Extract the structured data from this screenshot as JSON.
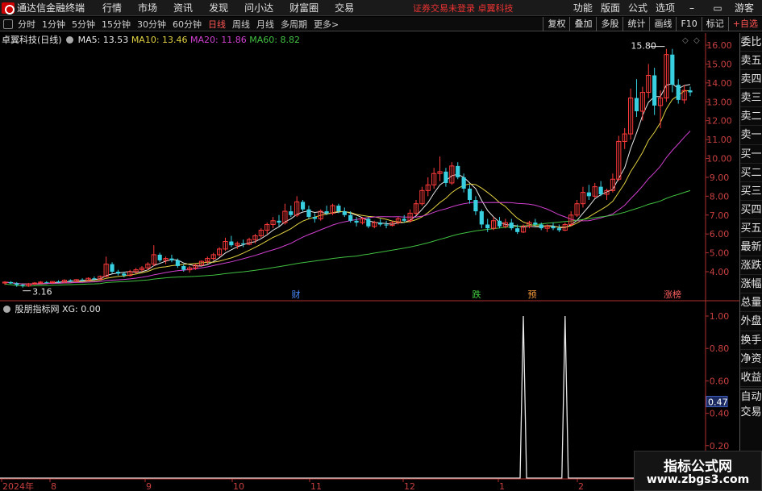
{
  "menubar": {
    "app_title": "通达信金融终端",
    "items": [
      "行情",
      "市场",
      "资讯",
      "发现",
      "问小达",
      "财富圈",
      "交易"
    ],
    "notice": "证券交易未登录  卓翼科技",
    "right_items": [
      "功能",
      "版面",
      "公式",
      "选项"
    ],
    "guest": "游客"
  },
  "periodbar": {
    "periods": [
      "分时",
      "1分钟",
      "5分钟",
      "15分钟",
      "30分钟",
      "60分钟",
      "日线",
      "周线",
      "月线",
      "多周期",
      "更多>"
    ],
    "active": "日线",
    "tools": [
      "复权",
      "叠加",
      "多股",
      "统计",
      "画线",
      "F10",
      "标记",
      "+自选"
    ]
  },
  "stock": {
    "name": "卓翼科技(日线)",
    "ma5": "MA5: 13.53",
    "ma10": "MA10: 13.46",
    "ma20": "MA20: 11.86",
    "ma60": "MA60: 8.82"
  },
  "indicator": {
    "name": "股朋指标网",
    "value": "XG: 0.00",
    "current_label": "0.47"
  },
  "sidebar": {
    "items": [
      "委比",
      "卖五",
      "卖四",
      "卖三",
      "卖二",
      "卖一",
      "买一",
      "买二",
      "买三",
      "买四",
      "买五",
      "最新",
      "涨跌",
      "涨幅",
      "总量",
      "外盘",
      "换手",
      "净资",
      "收益"
    ],
    "bottom": [
      "自动",
      "交易"
    ]
  },
  "chart_data": [
    {
      "type": "candlestick",
      "title": "卓翼科技(日线)",
      "ylim": [
        3.0,
        16.5
      ],
      "y_ticks": [
        "16.00",
        "15.00",
        "14.00",
        "13.00",
        "12.00",
        "11.00",
        "10.00",
        "9.00",
        "8.00",
        "7.00",
        "6.00",
        "5.00",
        "4.00"
      ],
      "annotations": [
        {
          "text": "15.80",
          "kind": "high"
        },
        {
          "text": "3.16",
          "kind": "low"
        }
      ],
      "event_markers": [
        {
          "text": "财",
          "color": "#4a8cff"
        },
        {
          "text": "跌",
          "color": "#40d040"
        },
        {
          "text": "预",
          "color": "#ffa040"
        },
        {
          "text": "涨榜",
          "color": "#ff6060"
        }
      ],
      "series": [
        {
          "name": "MA5",
          "color": "#e8e8e8"
        },
        {
          "name": "MA10",
          "color": "#e0d040"
        },
        {
          "name": "MA20",
          "color": "#d040d0"
        },
        {
          "name": "MA60",
          "color": "#40c040"
        }
      ],
      "ohlc_approx": [
        [
          3.4,
          3.5,
          3.3,
          3.45
        ],
        [
          3.45,
          3.5,
          3.35,
          3.38
        ],
        [
          3.38,
          3.45,
          3.2,
          3.3
        ],
        [
          3.3,
          3.36,
          3.16,
          3.25
        ],
        [
          3.25,
          3.4,
          3.2,
          3.35
        ],
        [
          3.35,
          3.45,
          3.3,
          3.4
        ],
        [
          3.4,
          3.5,
          3.35,
          3.45
        ],
        [
          3.45,
          3.5,
          3.38,
          3.42
        ],
        [
          3.42,
          3.5,
          3.35,
          3.48
        ],
        [
          3.48,
          3.55,
          3.4,
          3.45
        ],
        [
          3.45,
          3.6,
          3.4,
          3.55
        ],
        [
          3.55,
          3.6,
          3.45,
          3.5
        ],
        [
          3.5,
          3.6,
          3.45,
          3.58
        ],
        [
          3.58,
          3.65,
          3.5,
          3.55
        ],
        [
          3.55,
          3.7,
          3.5,
          3.65
        ],
        [
          3.65,
          3.75,
          3.55,
          3.6
        ],
        [
          3.6,
          3.8,
          3.55,
          3.75
        ],
        [
          3.75,
          4.8,
          3.7,
          4.4
        ],
        [
          4.4,
          4.5,
          3.9,
          4.0
        ],
        [
          4.0,
          4.1,
          3.8,
          3.9
        ],
        [
          3.9,
          4.0,
          3.7,
          3.8
        ],
        [
          3.8,
          4.1,
          3.75,
          4.0
        ],
        [
          4.0,
          4.2,
          3.9,
          4.1
        ],
        [
          4.1,
          4.3,
          4.0,
          4.2
        ],
        [
          4.2,
          4.5,
          4.1,
          4.4
        ],
        [
          4.4,
          5.4,
          4.3,
          4.9
        ],
        [
          4.9,
          5.0,
          4.5,
          4.6
        ],
        [
          4.6,
          4.8,
          4.4,
          4.7
        ],
        [
          4.7,
          4.9,
          4.5,
          4.6
        ],
        [
          4.6,
          4.7,
          4.2,
          4.3
        ],
        [
          4.3,
          4.4,
          4.0,
          4.1
        ],
        [
          4.1,
          4.3,
          3.95,
          4.2
        ],
        [
          4.2,
          4.4,
          4.1,
          4.35
        ],
        [
          4.35,
          4.6,
          4.3,
          4.55
        ],
        [
          4.55,
          4.8,
          4.4,
          4.7
        ],
        [
          4.7,
          5.0,
          4.6,
          4.9
        ],
        [
          4.9,
          5.3,
          4.8,
          5.2
        ],
        [
          5.2,
          5.8,
          5.1,
          5.6
        ],
        [
          5.6,
          5.9,
          5.3,
          5.4
        ],
        [
          5.4,
          5.6,
          5.2,
          5.5
        ],
        [
          5.5,
          5.7,
          5.3,
          5.45
        ],
        [
          5.45,
          5.8,
          5.4,
          5.7
        ],
        [
          5.7,
          6.0,
          5.5,
          5.9
        ],
        [
          5.9,
          6.3,
          5.8,
          6.2
        ],
        [
          6.2,
          6.6,
          6.0,
          6.5
        ],
        [
          6.5,
          6.9,
          6.3,
          6.7
        ],
        [
          6.7,
          7.0,
          6.4,
          6.6
        ],
        [
          6.6,
          7.6,
          6.5,
          7.2
        ],
        [
          7.2,
          7.5,
          6.9,
          7.0
        ],
        [
          7.0,
          8.0,
          6.9,
          7.7
        ],
        [
          7.7,
          7.8,
          7.2,
          7.3
        ],
        [
          7.3,
          7.5,
          6.8,
          6.9
        ],
        [
          6.9,
          7.1,
          6.6,
          6.8
        ],
        [
          6.8,
          7.3,
          6.7,
          7.2
        ],
        [
          7.2,
          7.5,
          7.0,
          7.1
        ],
        [
          7.1,
          7.6,
          7.0,
          7.5
        ],
        [
          7.5,
          7.6,
          7.1,
          7.2
        ],
        [
          7.2,
          7.4,
          6.9,
          7.0
        ],
        [
          7.0,
          7.2,
          6.6,
          6.7
        ],
        [
          6.7,
          6.9,
          6.4,
          6.6
        ],
        [
          6.6,
          6.9,
          6.5,
          6.8
        ],
        [
          6.8,
          6.9,
          6.3,
          6.4
        ],
        [
          6.4,
          6.7,
          6.3,
          6.6
        ],
        [
          6.6,
          6.8,
          6.4,
          6.5
        ],
        [
          6.5,
          6.7,
          6.3,
          6.45
        ],
        [
          6.45,
          6.7,
          6.4,
          6.6
        ],
        [
          6.6,
          6.9,
          6.5,
          6.8
        ],
        [
          6.8,
          7.0,
          6.6,
          6.7
        ],
        [
          6.7,
          7.3,
          6.6,
          7.1
        ],
        [
          7.1,
          7.8,
          7.0,
          7.6
        ],
        [
          7.6,
          8.5,
          7.5,
          8.3
        ],
        [
          8.3,
          9.0,
          8.0,
          8.6
        ],
        [
          8.6,
          9.5,
          8.4,
          9.2
        ],
        [
          9.2,
          10.1,
          8.8,
          9.3
        ],
        [
          9.3,
          9.5,
          8.5,
          8.7
        ],
        [
          8.7,
          9.8,
          8.6,
          9.6
        ],
        [
          9.6,
          9.8,
          8.9,
          9.0
        ],
        [
          9.0,
          9.2,
          8.2,
          8.4
        ],
        [
          8.4,
          8.6,
          7.6,
          7.8
        ],
        [
          7.8,
          8.0,
          7.0,
          7.2
        ],
        [
          7.2,
          7.3,
          6.3,
          6.5
        ],
        [
          6.5,
          6.8,
          6.1,
          6.3
        ],
        [
          6.3,
          6.9,
          6.2,
          6.7
        ],
        [
          6.7,
          6.9,
          6.3,
          6.4
        ],
        [
          6.4,
          6.8,
          6.3,
          6.6
        ],
        [
          6.6,
          6.8,
          6.2,
          6.3
        ],
        [
          6.3,
          6.5,
          6.0,
          6.1
        ],
        [
          6.1,
          6.5,
          6.05,
          6.4
        ],
        [
          6.4,
          6.7,
          6.3,
          6.6
        ],
        [
          6.6,
          6.8,
          6.4,
          6.5
        ],
        [
          6.5,
          6.6,
          6.2,
          6.3
        ],
        [
          6.3,
          6.5,
          6.1,
          6.4
        ],
        [
          6.4,
          6.6,
          6.2,
          6.3
        ],
        [
          6.3,
          6.5,
          6.1,
          6.2
        ],
        [
          6.2,
          6.6,
          6.15,
          6.5
        ],
        [
          6.5,
          7.2,
          6.4,
          7.0
        ],
        [
          7.0,
          7.8,
          6.9,
          7.6
        ],
        [
          7.6,
          8.5,
          7.4,
          8.2
        ],
        [
          8.2,
          8.6,
          7.8,
          8.0
        ],
        [
          8.0,
          8.7,
          7.9,
          8.5
        ],
        [
          8.5,
          8.8,
          8.0,
          8.1
        ],
        [
          8.1,
          8.4,
          7.8,
          8.3
        ],
        [
          8.3,
          9.2,
          8.2,
          8.9
        ],
        [
          8.9,
          11.2,
          8.8,
          10.9
        ],
        [
          10.9,
          11.6,
          10.5,
          11.3
        ],
        [
          11.3,
          13.7,
          11.0,
          13.2
        ],
        [
          13.2,
          14.2,
          12.2,
          12.5
        ],
        [
          12.5,
          13.8,
          12.0,
          13.5
        ],
        [
          13.5,
          15.0,
          13.2,
          14.4
        ],
        [
          14.4,
          14.8,
          12.3,
          12.8
        ],
        [
          12.8,
          13.6,
          11.6,
          13.2
        ],
        [
          13.2,
          15.8,
          13.0,
          15.5
        ],
        [
          15.5,
          15.8,
          13.5,
          13.9
        ],
        [
          13.9,
          14.2,
          12.9,
          13.1
        ],
        [
          13.1,
          13.9,
          12.9,
          13.6
        ],
        [
          13.6,
          13.8,
          13.3,
          13.5
        ]
      ]
    },
    {
      "type": "line",
      "title": "股朋指标网",
      "ylim": [
        0,
        1.1
      ],
      "y_ticks": [
        "1.00",
        "0.80",
        "0.60",
        "0.40",
        "0.20"
      ],
      "series": [
        {
          "name": "XG",
          "signal_days": [
            87,
            94
          ]
        }
      ]
    }
  ],
  "xaxis_labels": [
    "2024年",
    "8",
    "9",
    "10",
    "11",
    "12",
    "1",
    "2"
  ]
}
